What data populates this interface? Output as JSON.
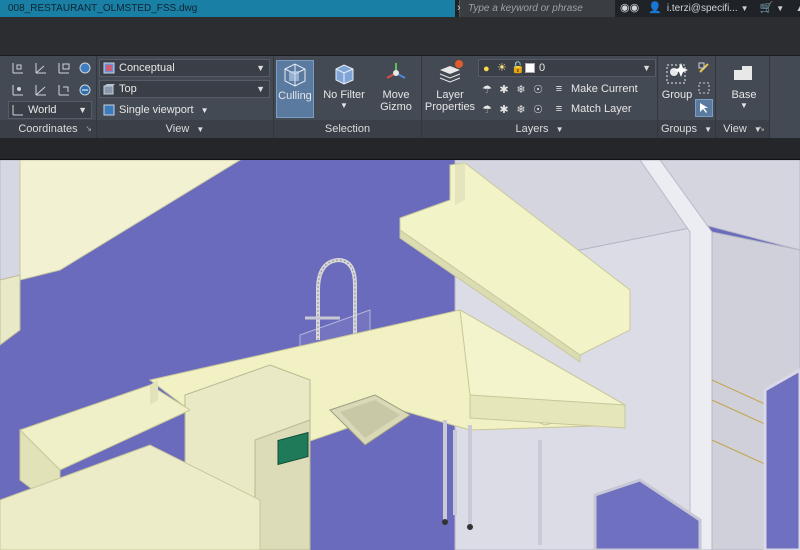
{
  "titlebar": {
    "file_name": "008_RESTAURANT_OLMSTED_FSS.dwg",
    "search_placeholder": "Type a keyword or phrase",
    "user_name": "i.terzi@specifi...",
    "icons": [
      "binoculars-icon",
      "user-icon",
      "cart-icon",
      "app-exchange-icon"
    ]
  },
  "ribbon": {
    "coordinates": {
      "label": "Coordinates",
      "world_dropdown": "World"
    },
    "view": {
      "label": "View",
      "visual_style": "Conceptual",
      "view_preset": "Top",
      "viewport_config": "Single viewport"
    },
    "selection": {
      "label": "Selection",
      "culling_label": "Culling",
      "no_filter_label": "No Filter",
      "move_gizmo_line1": "Move",
      "move_gizmo_line2": "Gizmo"
    },
    "layers": {
      "label": "Layers",
      "layer_properties_line1": "Layer",
      "layer_properties_line2": "Properties",
      "current_layer": "0",
      "make_current_label": "Make Current",
      "match_layer_label": "Match Layer"
    },
    "groups": {
      "label": "Groups",
      "group_label": "Group"
    },
    "view2": {
      "label": "View",
      "base_label": "Base"
    }
  },
  "colors": {
    "file_tab": "#1a7fa5",
    "ribbon": "#444a53",
    "viewport_floor": "#6f6fbe",
    "equipment": "#efefc6",
    "culling_active": "#5b7aa0"
  }
}
